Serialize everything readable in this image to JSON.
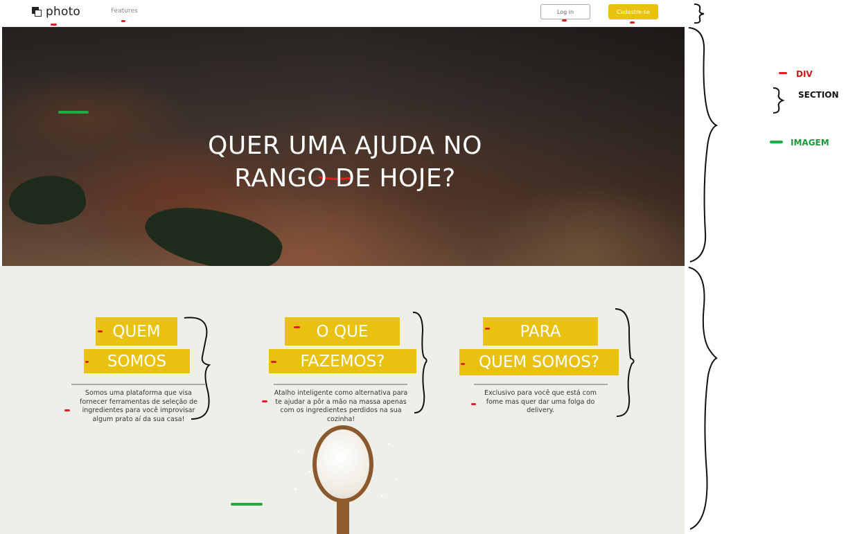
{
  "navbar": {
    "brand": "photo",
    "features_link": "Features",
    "login_label": "Log in",
    "signup_label": "Cadastre-se",
    "accent_color": "#e8c20f"
  },
  "hero": {
    "line1": "QUER UMA AJUDA NO",
    "line2": "RANGO DE HOJE?"
  },
  "features": [
    {
      "title_line1": "QUEM",
      "title_line2": "SOMOS",
      "text": "Somos uma plataforma que visa fornecer ferramentas de seleção de ingredientes para você improvisar algum prato aí da sua casa!"
    },
    {
      "title_line1": "O QUE",
      "title_line2": "FAZEMOS?",
      "text": "Atalho inteligente como alternativa para te ajudar a pôr a mão na massa apenas com os ingredientes perdidos na sua cozinha!"
    },
    {
      "title_line1": "PARA",
      "title_line2": "QUEM SOMOS?",
      "text": "Exclusivo para você que está com fome mas quer dar uma folga do delivery."
    }
  ],
  "legend": {
    "div": "DIV",
    "section": "SECTION",
    "image": "IMAGEM",
    "div_color": "#e02020",
    "image_color": "#22aa44"
  }
}
